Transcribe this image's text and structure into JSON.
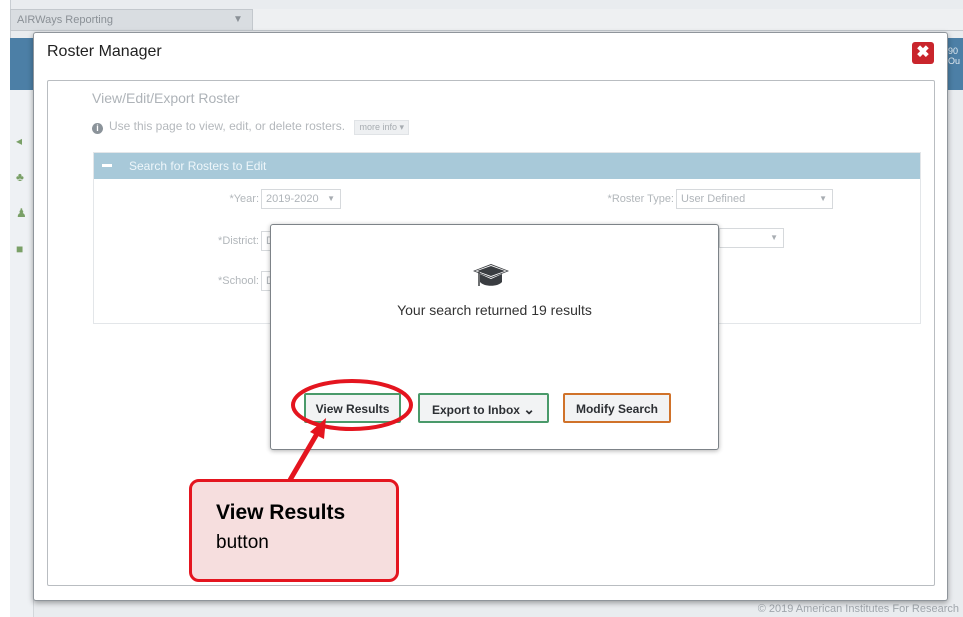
{
  "app": {
    "menu_label": "AIRWays Reporting",
    "menu_arrow": "▼",
    "right_strip_text": "90 Ou",
    "footer": "© 2019 American Institutes For Research"
  },
  "modal": {
    "title": "Roster Manager",
    "close_glyph": "✖"
  },
  "page": {
    "heading": "View/Edit/Export Roster",
    "info_text": "Use this page to view, edit, or delete rosters.",
    "more_info": "more info ▾",
    "panel_title": "Search for Rosters to Edit",
    "fields": {
      "year_label": "*Year:",
      "year_value": "2019-2020",
      "roster_type_label": "*Roster Type:",
      "roster_type_value": "User Defined",
      "district_label": "*District:",
      "district_value": "D",
      "school_label": "*School:",
      "school_value": "D"
    }
  },
  "popup": {
    "icon": "graduation-cap",
    "message": "Your search returned 19 results",
    "buttons": {
      "view_results": "View Results",
      "export_to_inbox": "Export to Inbox",
      "export_chevron": "⌄",
      "modify_search": "Modify Search"
    }
  },
  "annotation": {
    "title": "View Results",
    "subtitle": "button",
    "color": "#e4151f"
  }
}
